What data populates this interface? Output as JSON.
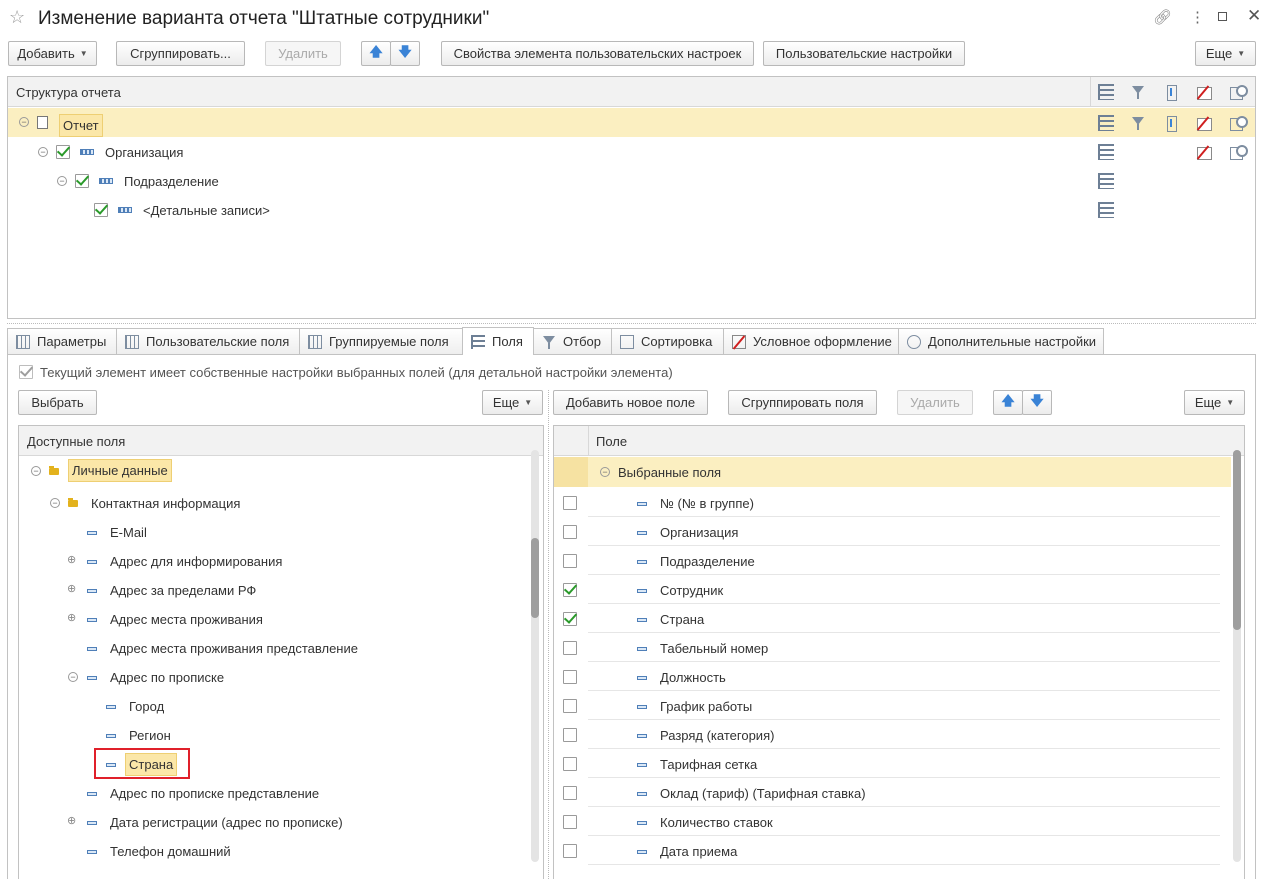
{
  "window": {
    "title": "Изменение варианта отчета \"Штатные сотрудники\""
  },
  "toolbar": {
    "add": "Добавить",
    "group": "Сгруппировать...",
    "delete": "Удалить",
    "element_props": "Свойства элемента пользовательских настроек",
    "user_settings": "Пользовательские настройки",
    "more": "Еще"
  },
  "structure": {
    "header": "Структура отчета",
    "items": [
      {
        "label": "Отчет"
      },
      {
        "label": "Организация"
      },
      {
        "label": "Подразделение"
      },
      {
        "label": "<Детальные записи>"
      }
    ]
  },
  "tabs": [
    {
      "label": "Параметры"
    },
    {
      "label": "Пользовательские поля"
    },
    {
      "label": "Группируемые поля"
    },
    {
      "label": "Поля"
    },
    {
      "label": "Отбор"
    },
    {
      "label": "Сортировка"
    },
    {
      "label": "Условное оформление"
    },
    {
      "label": "Дополнительные настройки"
    }
  ],
  "own_settings_label": "Текущий элемент имеет собственные настройки выбранных полей (для детальной настройки элемента)",
  "left": {
    "select": "Выбрать",
    "more": "Еще",
    "header": "Доступные поля",
    "items": [
      {
        "label": "Личные данные"
      },
      {
        "label": "Контактная информация"
      },
      {
        "label": "E-Mail"
      },
      {
        "label": "Адрес для информирования"
      },
      {
        "label": "Адрес за пределами РФ"
      },
      {
        "label": "Адрес места проживания"
      },
      {
        "label": "Адрес места проживания представление"
      },
      {
        "label": "Адрес по прописке"
      },
      {
        "label": "Город"
      },
      {
        "label": "Регион"
      },
      {
        "label": "Страна"
      },
      {
        "label": "Адрес по прописке представление"
      },
      {
        "label": "Дата регистрации (адрес по прописке)"
      },
      {
        "label": "Телефон домашний"
      }
    ]
  },
  "right": {
    "add_field": "Добавить новое поле",
    "group_fields": "Сгруппировать поля",
    "delete": "Удалить",
    "more": "Еще",
    "header": "Поле",
    "group_label": "Выбранные поля",
    "items": [
      {
        "label": "№ (№ в группе)",
        "checked": false
      },
      {
        "label": "Организация",
        "checked": false
      },
      {
        "label": "Подразделение",
        "checked": false
      },
      {
        "label": "Сотрудник",
        "checked": true
      },
      {
        "label": "Страна",
        "checked": true
      },
      {
        "label": "Табельный номер",
        "checked": false
      },
      {
        "label": "Должность",
        "checked": false
      },
      {
        "label": "График работы",
        "checked": false
      },
      {
        "label": "Разряд (категория)",
        "checked": false
      },
      {
        "label": "Тарифная сетка",
        "checked": false
      },
      {
        "label": "Оклад (тариф) (Тарифная ставка)",
        "checked": false
      },
      {
        "label": "Количество ставок",
        "checked": false
      },
      {
        "label": "Дата приема",
        "checked": false
      }
    ]
  },
  "colors": {
    "selection": "#fbe7a8",
    "highlight_frame": "#e0202a",
    "check": "#2a9a2a"
  }
}
